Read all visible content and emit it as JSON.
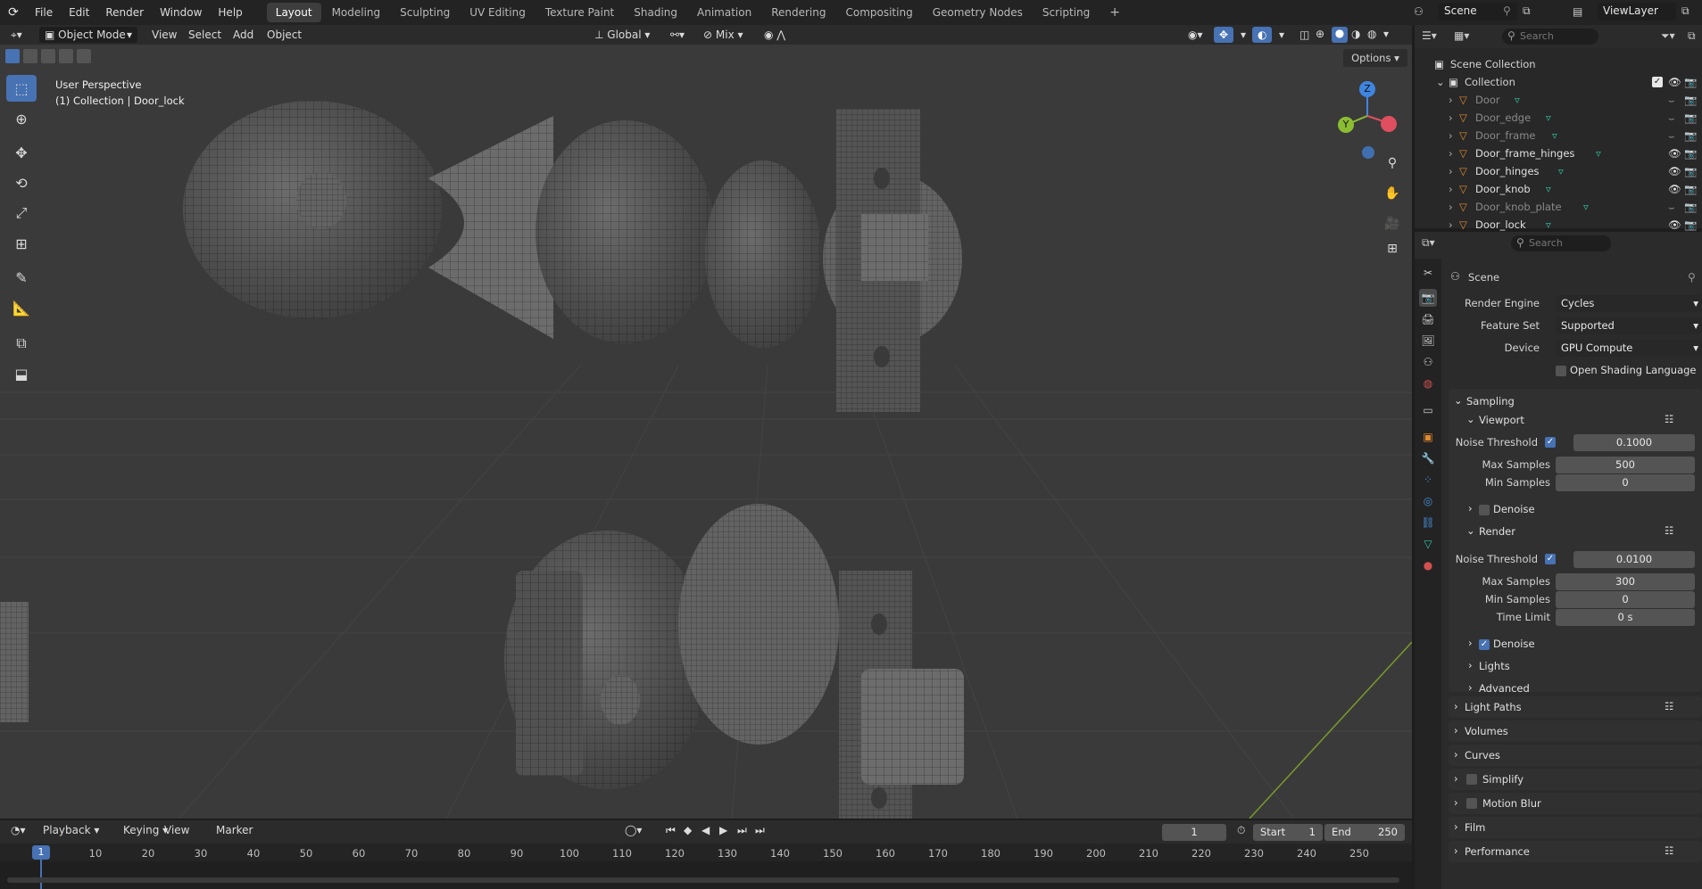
{
  "topbar": {
    "menus": [
      "File",
      "Edit",
      "Render",
      "Window",
      "Help"
    ],
    "workspaces": [
      "Layout",
      "Modeling",
      "Sculpting",
      "UV Editing",
      "Texture Paint",
      "Shading",
      "Animation",
      "Rendering",
      "Compositing",
      "Geometry Nodes",
      "Scripting"
    ],
    "active_workspace": "Layout",
    "add_tab": "+",
    "scene": "Scene",
    "view_layer": "ViewLayer"
  },
  "viewport_header": {
    "mode": "Object Mode",
    "menus": [
      "View",
      "Select",
      "Add",
      "Object"
    ],
    "orientation": "Global",
    "snap_mode": "Mix",
    "options": "Options"
  },
  "viewport": {
    "perspective": "User Perspective",
    "context": "(1) Collection | Door_lock",
    "gizmo": {
      "x": "X",
      "y": "Y",
      "z": "Z"
    }
  },
  "outliner": {
    "search_placeholder": "Search",
    "scene_collection": "Scene Collection",
    "collection": "Collection",
    "items": [
      {
        "name": "Door",
        "visible": false
      },
      {
        "name": "Door_edge",
        "visible": false
      },
      {
        "name": "Door_frame",
        "visible": false
      },
      {
        "name": "Door_frame_hinges",
        "visible": true
      },
      {
        "name": "Door_hinges",
        "visible": true
      },
      {
        "name": "Door_knob",
        "visible": true
      },
      {
        "name": "Door_knob_plate",
        "visible": false
      },
      {
        "name": "Door_lock",
        "visible": true
      }
    ]
  },
  "properties": {
    "search_placeholder": "Search",
    "context": "Scene",
    "render_engine_label": "Render Engine",
    "render_engine": "Cycles",
    "feature_set_label": "Feature Set",
    "feature_set": "Supported",
    "device_label": "Device",
    "device": "GPU Compute",
    "osl_label": "Open Shading Language",
    "sampling": "Sampling",
    "viewport": {
      "title": "Viewport",
      "noise_threshold_label": "Noise Threshold",
      "noise_threshold": "0.1000",
      "max_samples_label": "Max Samples",
      "max_samples": "500",
      "min_samples_label": "Min Samples",
      "min_samples": "0",
      "denoise_label": "Denoise"
    },
    "render": {
      "title": "Render",
      "noise_threshold_label": "Noise Threshold",
      "noise_threshold": "0.0100",
      "max_samples_label": "Max Samples",
      "max_samples": "300",
      "min_samples_label": "Min Samples",
      "min_samples": "0",
      "time_limit_label": "Time Limit",
      "time_limit": "0 s",
      "denoise_label": "Denoise"
    },
    "subsections": [
      "Lights",
      "Advanced"
    ],
    "panels": [
      "Light Paths",
      "Volumes",
      "Curves",
      "Simplify",
      "Motion Blur",
      "Film",
      "Performance"
    ]
  },
  "timeline": {
    "menus": [
      "Playback",
      "Keying",
      "View",
      "Marker"
    ],
    "current_frame": "1",
    "start_label": "Start",
    "start": "1",
    "end_label": "End",
    "end": "250",
    "playhead": "1",
    "ticks": [
      "10",
      "20",
      "30",
      "40",
      "50",
      "60",
      "70",
      "80",
      "90",
      "100",
      "110",
      "120",
      "130",
      "140",
      "150",
      "160",
      "170",
      "180",
      "190",
      "200",
      "210",
      "220",
      "230",
      "240",
      "250"
    ]
  },
  "colors": {
    "accent": "#4772b3",
    "viewport_bg": "#3a3a3a",
    "x_axis": "#e04f5f",
    "y_axis": "#8bbd32",
    "z_axis": "#3f86e0",
    "mesh_icon": "#2ec4a0"
  }
}
